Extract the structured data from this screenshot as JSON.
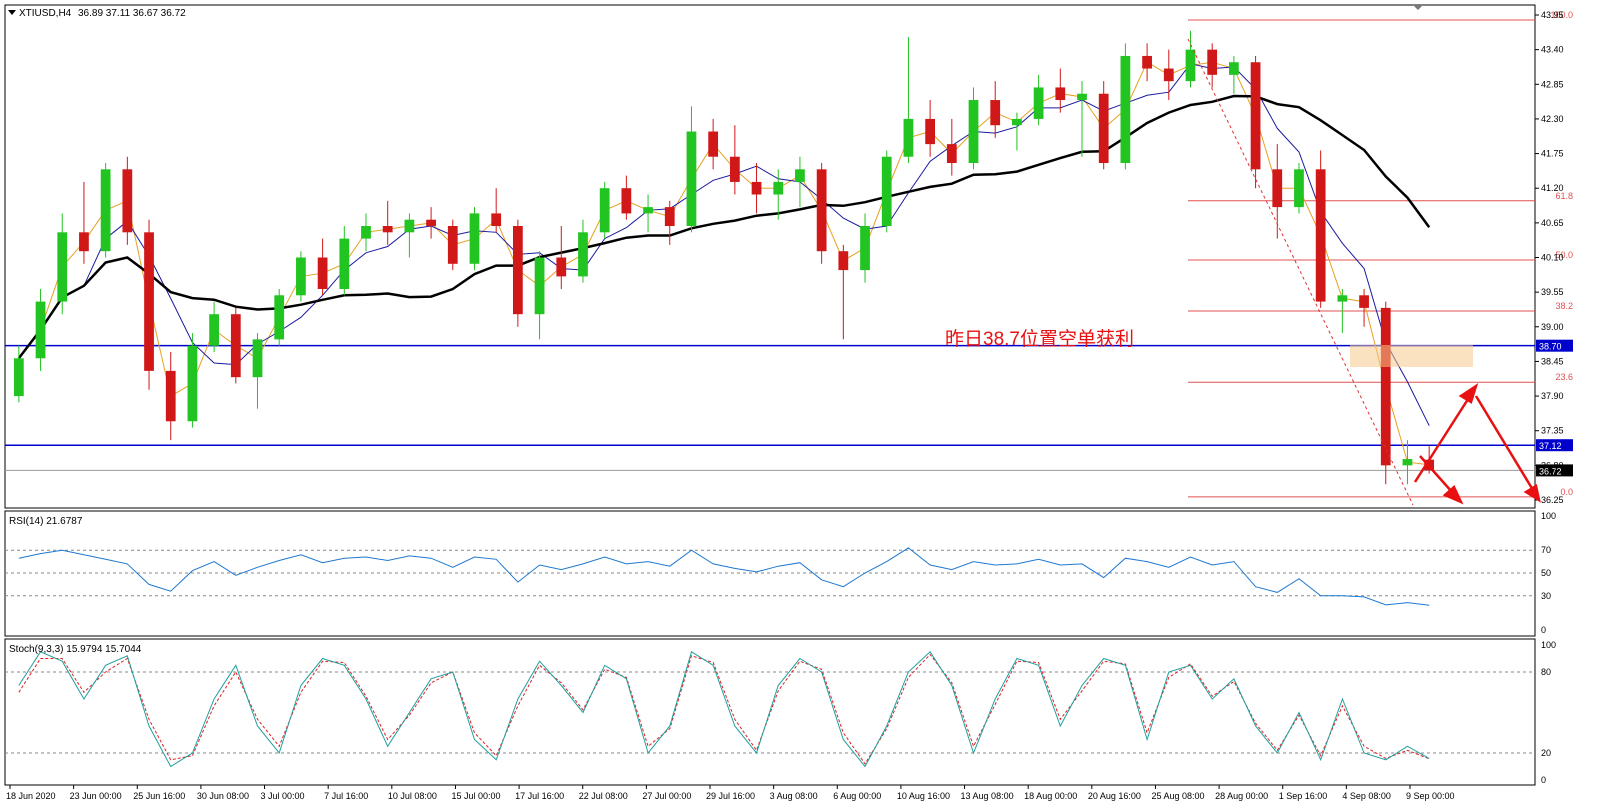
{
  "chart_data": {
    "type": "candlestick",
    "symbol_header": "XTIUSD,H4",
    "ohlc_header": "36.89 37.11 36.67 36.72",
    "price_axis": {
      "ticks": [
        "43.95",
        "43.40",
        "42.85",
        "42.30",
        "41.75",
        "41.20",
        "40.65",
        "40.10",
        "39.55",
        "39.00",
        "38.45",
        "37.90",
        "37.35",
        "36.80",
        "36.25"
      ],
      "ylim": [
        36.25,
        43.95
      ]
    },
    "time_axis": [
      "18 Jun 2020",
      "23 Jun 00:00",
      "25 Jun 16:00",
      "30 Jun 08:00",
      "3 Jul 00:00",
      "7 Jul 16:00",
      "10 Jul 08:00",
      "15 Jul 00:00",
      "17 Jul 16:00",
      "22 Jul 08:00",
      "27 Jul 00:00",
      "29 Jul 16:00",
      "3 Aug 08:00",
      "6 Aug 00:00",
      "10 Aug 16:00",
      "13 Aug 08:00",
      "18 Aug 00:00",
      "20 Aug 16:00",
      "25 Aug 08:00",
      "28 Aug 00:00",
      "1 Sep 16:00",
      "4 Sep 08:00",
      "9 Sep 00:00"
    ],
    "bars": [
      {
        "o": 37.9,
        "h": 38.7,
        "l": 37.8,
        "c": 38.5
      },
      {
        "o": 38.5,
        "h": 39.6,
        "l": 38.3,
        "c": 39.4
      },
      {
        "o": 39.4,
        "h": 40.8,
        "l": 39.2,
        "c": 40.5
      },
      {
        "o": 40.5,
        "h": 41.3,
        "l": 40.0,
        "c": 40.2
      },
      {
        "o": 40.2,
        "h": 41.6,
        "l": 40.1,
        "c": 41.5
      },
      {
        "o": 41.5,
        "h": 41.7,
        "l": 40.3,
        "c": 40.5
      },
      {
        "o": 40.5,
        "h": 40.7,
        "l": 38.0,
        "c": 38.3
      },
      {
        "o": 38.3,
        "h": 38.6,
        "l": 37.2,
        "c": 37.5
      },
      {
        "o": 37.5,
        "h": 38.9,
        "l": 37.4,
        "c": 38.7
      },
      {
        "o": 38.7,
        "h": 39.4,
        "l": 38.6,
        "c": 39.2
      },
      {
        "o": 39.2,
        "h": 39.3,
        "l": 38.1,
        "c": 38.2
      },
      {
        "o": 38.2,
        "h": 38.9,
        "l": 37.7,
        "c": 38.8
      },
      {
        "o": 38.8,
        "h": 39.6,
        "l": 38.7,
        "c": 39.5
      },
      {
        "o": 39.5,
        "h": 40.2,
        "l": 39.4,
        "c": 40.1
      },
      {
        "o": 40.1,
        "h": 40.4,
        "l": 39.5,
        "c": 39.6
      },
      {
        "o": 39.6,
        "h": 40.6,
        "l": 39.5,
        "c": 40.4
      },
      {
        "o": 40.4,
        "h": 40.8,
        "l": 40.2,
        "c": 40.6
      },
      {
        "o": 40.6,
        "h": 41.0,
        "l": 40.3,
        "c": 40.5
      },
      {
        "o": 40.5,
        "h": 40.8,
        "l": 40.1,
        "c": 40.7
      },
      {
        "o": 40.7,
        "h": 40.9,
        "l": 40.4,
        "c": 40.6
      },
      {
        "o": 40.6,
        "h": 40.7,
        "l": 39.9,
        "c": 40.0
      },
      {
        "o": 40.0,
        "h": 40.9,
        "l": 39.9,
        "c": 40.8
      },
      {
        "o": 40.8,
        "h": 41.2,
        "l": 40.5,
        "c": 40.6
      },
      {
        "o": 40.6,
        "h": 40.7,
        "l": 39.0,
        "c": 39.2
      },
      {
        "o": 39.2,
        "h": 40.2,
        "l": 38.8,
        "c": 40.1
      },
      {
        "o": 40.1,
        "h": 40.6,
        "l": 39.6,
        "c": 39.8
      },
      {
        "o": 39.8,
        "h": 40.7,
        "l": 39.7,
        "c": 40.5
      },
      {
        "o": 40.5,
        "h": 41.3,
        "l": 40.4,
        "c": 41.2
      },
      {
        "o": 41.2,
        "h": 41.4,
        "l": 40.7,
        "c": 40.8
      },
      {
        "o": 40.8,
        "h": 41.1,
        "l": 40.5,
        "c": 40.9
      },
      {
        "o": 40.9,
        "h": 41.0,
        "l": 40.3,
        "c": 40.6
      },
      {
        "o": 40.6,
        "h": 42.5,
        "l": 40.5,
        "c": 42.1
      },
      {
        "o": 42.1,
        "h": 42.3,
        "l": 41.5,
        "c": 41.7
      },
      {
        "o": 41.7,
        "h": 42.2,
        "l": 41.1,
        "c": 41.3
      },
      {
        "o": 41.3,
        "h": 41.6,
        "l": 40.8,
        "c": 41.1
      },
      {
        "o": 41.1,
        "h": 41.5,
        "l": 40.7,
        "c": 41.3
      },
      {
        "o": 41.3,
        "h": 41.7,
        "l": 40.9,
        "c": 41.5
      },
      {
        "o": 41.5,
        "h": 41.6,
        "l": 40.0,
        "c": 40.2
      },
      {
        "o": 40.2,
        "h": 40.3,
        "l": 38.8,
        "c": 39.9
      },
      {
        "o": 39.9,
        "h": 40.8,
        "l": 39.7,
        "c": 40.6
      },
      {
        "o": 40.6,
        "h": 41.8,
        "l": 40.5,
        "c": 41.7
      },
      {
        "o": 41.7,
        "h": 43.6,
        "l": 41.6,
        "c": 42.3
      },
      {
        "o": 42.3,
        "h": 42.6,
        "l": 41.7,
        "c": 41.9
      },
      {
        "o": 41.9,
        "h": 42.3,
        "l": 41.4,
        "c": 41.6
      },
      {
        "o": 41.6,
        "h": 42.8,
        "l": 41.5,
        "c": 42.6
      },
      {
        "o": 42.6,
        "h": 42.9,
        "l": 42.0,
        "c": 42.2
      },
      {
        "o": 42.2,
        "h": 42.4,
        "l": 41.8,
        "c": 42.3
      },
      {
        "o": 42.3,
        "h": 43.0,
        "l": 42.2,
        "c": 42.8
      },
      {
        "o": 42.8,
        "h": 43.1,
        "l": 42.4,
        "c": 42.6
      },
      {
        "o": 42.6,
        "h": 42.9,
        "l": 41.7,
        "c": 42.7
      },
      {
        "o": 42.7,
        "h": 42.9,
        "l": 41.5,
        "c": 41.6
      },
      {
        "o": 41.6,
        "h": 43.5,
        "l": 41.5,
        "c": 43.3
      },
      {
        "o": 43.3,
        "h": 43.5,
        "l": 42.9,
        "c": 43.1
      },
      {
        "o": 43.1,
        "h": 43.4,
        "l": 42.6,
        "c": 42.9
      },
      {
        "o": 42.9,
        "h": 43.7,
        "l": 42.8,
        "c": 43.4
      },
      {
        "o": 43.4,
        "h": 43.5,
        "l": 42.8,
        "c": 43.0
      },
      {
        "o": 43.0,
        "h": 43.3,
        "l": 42.7,
        "c": 43.2
      },
      {
        "o": 43.2,
        "h": 43.3,
        "l": 41.2,
        "c": 41.5
      },
      {
        "o": 41.5,
        "h": 41.9,
        "l": 40.4,
        "c": 40.9
      },
      {
        "o": 40.9,
        "h": 41.6,
        "l": 40.8,
        "c": 41.5
      },
      {
        "o": 41.5,
        "h": 41.8,
        "l": 39.3,
        "c": 39.4
      },
      {
        "o": 39.4,
        "h": 39.6,
        "l": 38.9,
        "c": 39.5
      },
      {
        "o": 39.5,
        "h": 39.6,
        "l": 39.0,
        "c": 39.3
      },
      {
        "o": 39.3,
        "h": 39.4,
        "l": 36.5,
        "c": 36.8
      },
      {
        "o": 36.8,
        "h": 37.2,
        "l": 36.5,
        "c": 36.9
      },
      {
        "o": 36.89,
        "h": 37.11,
        "l": 36.67,
        "c": 36.72
      }
    ],
    "moving_averages": [
      {
        "name": "MA fast",
        "color": "#e6a020"
      },
      {
        "name": "MA mid",
        "color": "#1a1aa0"
      },
      {
        "name": "MA slow",
        "color": "#000000"
      }
    ],
    "fibonacci": {
      "color": "#e05050",
      "levels": [
        {
          "label": "100.0",
          "price": 43.87
        },
        {
          "label": "61.8",
          "price": 41.0
        },
        {
          "label": "50.0",
          "price": 40.06
        },
        {
          "label": "38.2",
          "price": 39.25
        },
        {
          "label": "23.6",
          "price": 38.12
        },
        {
          "label": "0.0",
          "price": 36.3
        }
      ]
    },
    "horizontal_lines": [
      {
        "label": "38.70",
        "price": 38.7,
        "color": "#0000cc"
      },
      {
        "label": "37.12",
        "price": 37.12,
        "color": "#0000cc"
      }
    ],
    "current_price": {
      "label": "36.72",
      "price": 36.72
    },
    "annotation": "昨日38.7位置空单获利",
    "rsi": {
      "label": "RSI(14) 21.6787",
      "ticks": [
        "100",
        "70",
        "50",
        "30",
        "0"
      ],
      "levels": [
        70,
        50,
        30
      ],
      "values": [
        63,
        67,
        70,
        66,
        62,
        58,
        40,
        34,
        52,
        60,
        48,
        55,
        61,
        66,
        59,
        63,
        64,
        61,
        65,
        63,
        55,
        64,
        62,
        42,
        57,
        53,
        58,
        64,
        58,
        60,
        56,
        70,
        58,
        54,
        51,
        56,
        59,
        44,
        38,
        50,
        60,
        72,
        57,
        53,
        60,
        57,
        58,
        62,
        57,
        58,
        46,
        63,
        60,
        55,
        64,
        57,
        60,
        38,
        33,
        45,
        30,
        30,
        29,
        22,
        24,
        21.68
      ],
      "color": "#1e78d0"
    },
    "stoch": {
      "label": "Stoch(9,3,3) 15.9794 15.7044",
      "ticks": [
        "100",
        "80",
        "20",
        "0"
      ],
      "levels": [
        80,
        20
      ],
      "main": [
        70,
        95,
        88,
        60,
        85,
        92,
        40,
        10,
        20,
        60,
        85,
        40,
        20,
        70,
        90,
        85,
        60,
        25,
        50,
        75,
        80,
        30,
        15,
        60,
        88,
        70,
        50,
        85,
        75,
        20,
        40,
        95,
        85,
        40,
        20,
        70,
        90,
        80,
        30,
        10,
        40,
        80,
        95,
        70,
        20,
        60,
        90,
        85,
        40,
        70,
        90,
        85,
        30,
        80,
        85,
        60,
        75,
        40,
        20,
        50,
        15,
        60,
        20,
        15,
        25,
        15.98
      ],
      "signal": [
        65,
        90,
        90,
        65,
        80,
        90,
        45,
        15,
        18,
        55,
        80,
        45,
        25,
        65,
        88,
        87,
        62,
        30,
        48,
        72,
        80,
        35,
        18,
        55,
        85,
        72,
        52,
        82,
        76,
        25,
        38,
        92,
        87,
        45,
        22,
        66,
        88,
        82,
        35,
        12,
        38,
        76,
        93,
        72,
        25,
        56,
        88,
        87,
        45,
        66,
        88,
        86,
        35,
        76,
        86,
        62,
        73,
        42,
        22,
        48,
        18,
        55,
        25,
        16,
        22,
        15.7
      ],
      "main_color": "#20a0a0",
      "signal_color": "#e02020"
    }
  }
}
